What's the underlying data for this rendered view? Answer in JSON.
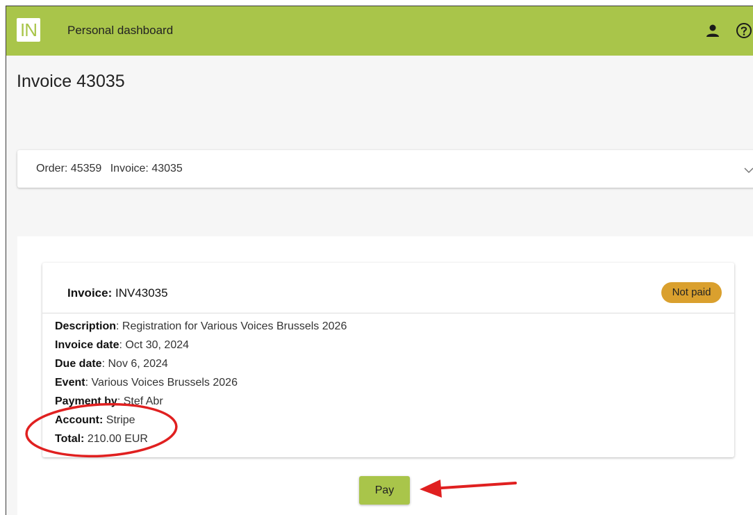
{
  "header": {
    "logo_text": "IN",
    "title": "Personal dashboard",
    "icons": [
      "user-icon",
      "help-icon"
    ],
    "accent_color": "#a9c54a"
  },
  "page": {
    "title": "Invoice 43035"
  },
  "order_panel": {
    "order": "Order: 45359",
    "invoice": "Invoice: 43035"
  },
  "invoice": {
    "label": "Invoice:",
    "number": "INV43035",
    "status": "Not paid",
    "status_color": "#daa02e",
    "details": [
      {
        "label": "Description",
        "sep": ":",
        "value": "Registration for Various Voices Brussels 2026"
      },
      {
        "label": "Invoice date",
        "sep": ":",
        "value": "Oct 30, 2024"
      },
      {
        "label": "Due date",
        "sep": ":",
        "value": "Nov 6, 2024"
      },
      {
        "label": "Event",
        "sep": ":",
        "value": "Various Voices Brussels 2026"
      },
      {
        "label": "Payment by",
        "sep": ":",
        "value": "Stef Abr"
      },
      {
        "label": "Account:",
        "sep": "",
        "value": "Stripe"
      },
      {
        "label": "Total:",
        "sep": "",
        "value": "210.00 EUR"
      }
    ]
  },
  "actions": {
    "pay_label": "Pay"
  },
  "annotation_color": "#e02020"
}
